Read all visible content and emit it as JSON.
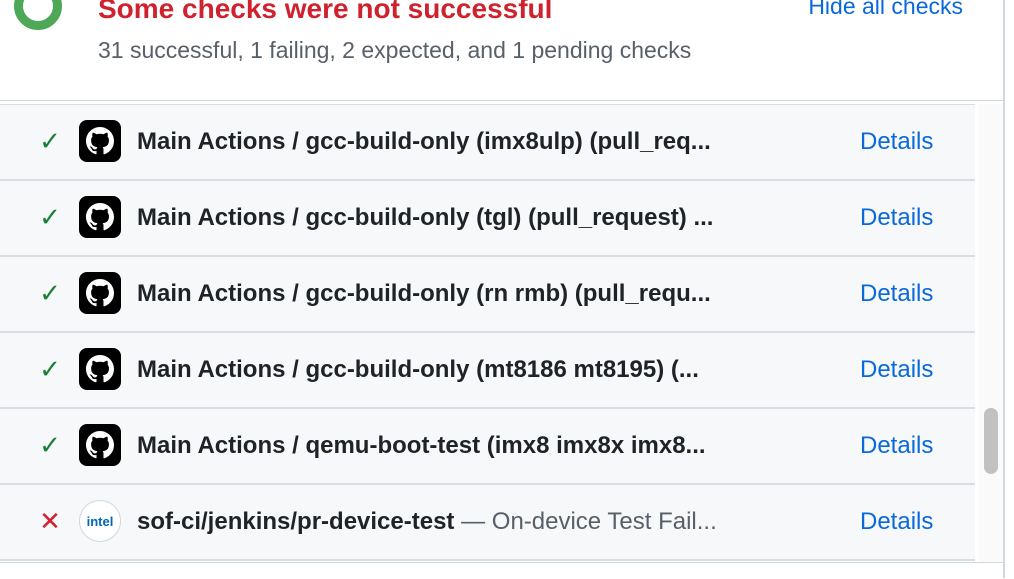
{
  "header": {
    "title": "Some checks were not successful",
    "summary": "31 successful, 1 failing, 2 expected, and 1 pending checks",
    "hide_link": "Hide all checks"
  },
  "colors": {
    "success": "#1a7f37",
    "failure": "#cf222e",
    "link": "#0969da"
  },
  "checks": [
    {
      "status": "success",
      "status_icon": "check-icon",
      "avatar_icon": "github-icon",
      "name": "Main Actions / gcc-build-only (imx8ulp) (pull_req...",
      "desc": "",
      "details": "Details"
    },
    {
      "status": "success",
      "status_icon": "check-icon",
      "avatar_icon": "github-icon",
      "name": "Main Actions / gcc-build-only (tgl) (pull_request) ...",
      "desc": "",
      "details": "Details"
    },
    {
      "status": "success",
      "status_icon": "check-icon",
      "avatar_icon": "github-icon",
      "name": "Main Actions / gcc-build-only (rn rmb) (pull_requ...",
      "desc": "",
      "details": "Details"
    },
    {
      "status": "success",
      "status_icon": "check-icon",
      "avatar_icon": "github-icon",
      "name": "Main Actions / gcc-build-only (mt8186 mt8195) (...",
      "desc": "",
      "details": "Details"
    },
    {
      "status": "success",
      "status_icon": "check-icon",
      "avatar_icon": "github-icon",
      "name": "Main Actions / qemu-boot-test (imx8 imx8x imx8...",
      "desc": "",
      "details": "Details"
    },
    {
      "status": "failure",
      "status_icon": "x-icon",
      "avatar_icon": "intel-logo-icon",
      "avatar_text": "intel",
      "name": "sof-ci/jenkins/pr-device-test",
      "desc": " — On-device Test Fail...",
      "details": "Details"
    }
  ]
}
